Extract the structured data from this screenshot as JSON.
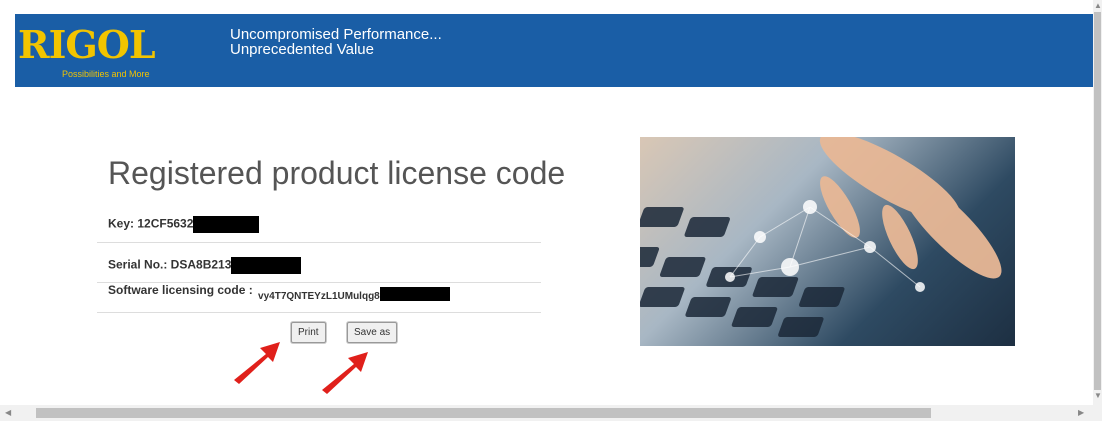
{
  "header": {
    "logo": "RIGOL",
    "logo_tagline": "Possibilities and More",
    "tagline_line1": "Uncompromised Performance...",
    "tagline_line2": "Unprecedented Value"
  },
  "main": {
    "title": "Registered product license code",
    "key_label": "Key: 12CF5632",
    "serial_label": "Serial No.: DSA8B213",
    "software_label": "Software licensing code :",
    "software_code": "vy4T7QNTEYzL1UMulqg8",
    "print_button": "Print",
    "save_button": "Save as"
  },
  "colors": {
    "header_bg": "#1a5ea6",
    "logo": "#f2c400",
    "annotation_arrow": "#e0201b"
  },
  "icons": {
    "photo": "hands-typing-on-keyboard-network-photo",
    "arrow": "red-annotation-arrow"
  }
}
